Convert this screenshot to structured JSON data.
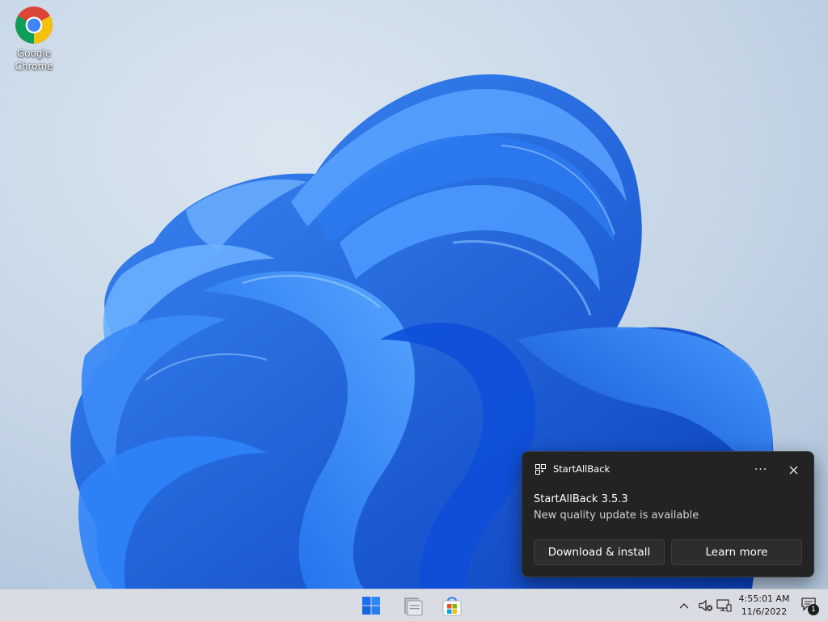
{
  "desktop": {
    "icons": [
      {
        "label": "Google Chrome",
        "icon": "chrome-icon"
      }
    ]
  },
  "toast": {
    "app_name": "StartAllBack",
    "more_label": "···",
    "title": "StartAllBack 3.5.3",
    "subtitle": "New quality update is available",
    "buttons": {
      "download": "Download & install",
      "learn_more": "Learn more"
    }
  },
  "taskbar": {
    "pinned": [
      {
        "name": "Start",
        "icon": "windows-start-icon"
      },
      {
        "name": "File Explorer",
        "icon": "folder-icon"
      },
      {
        "name": "Microsoft Store",
        "icon": "store-icon"
      }
    ],
    "tray": {
      "icons": [
        "chevron-up-icon",
        "volume-muted-icon",
        "network-icon"
      ],
      "time": "4:55:01 AM",
      "date": "11/6/2022",
      "notification_count": "1"
    }
  },
  "colors": {
    "accent_blue": "#1a6ff0",
    "toast_bg": "#232323",
    "taskbar_bg": "#d9dde3"
  }
}
